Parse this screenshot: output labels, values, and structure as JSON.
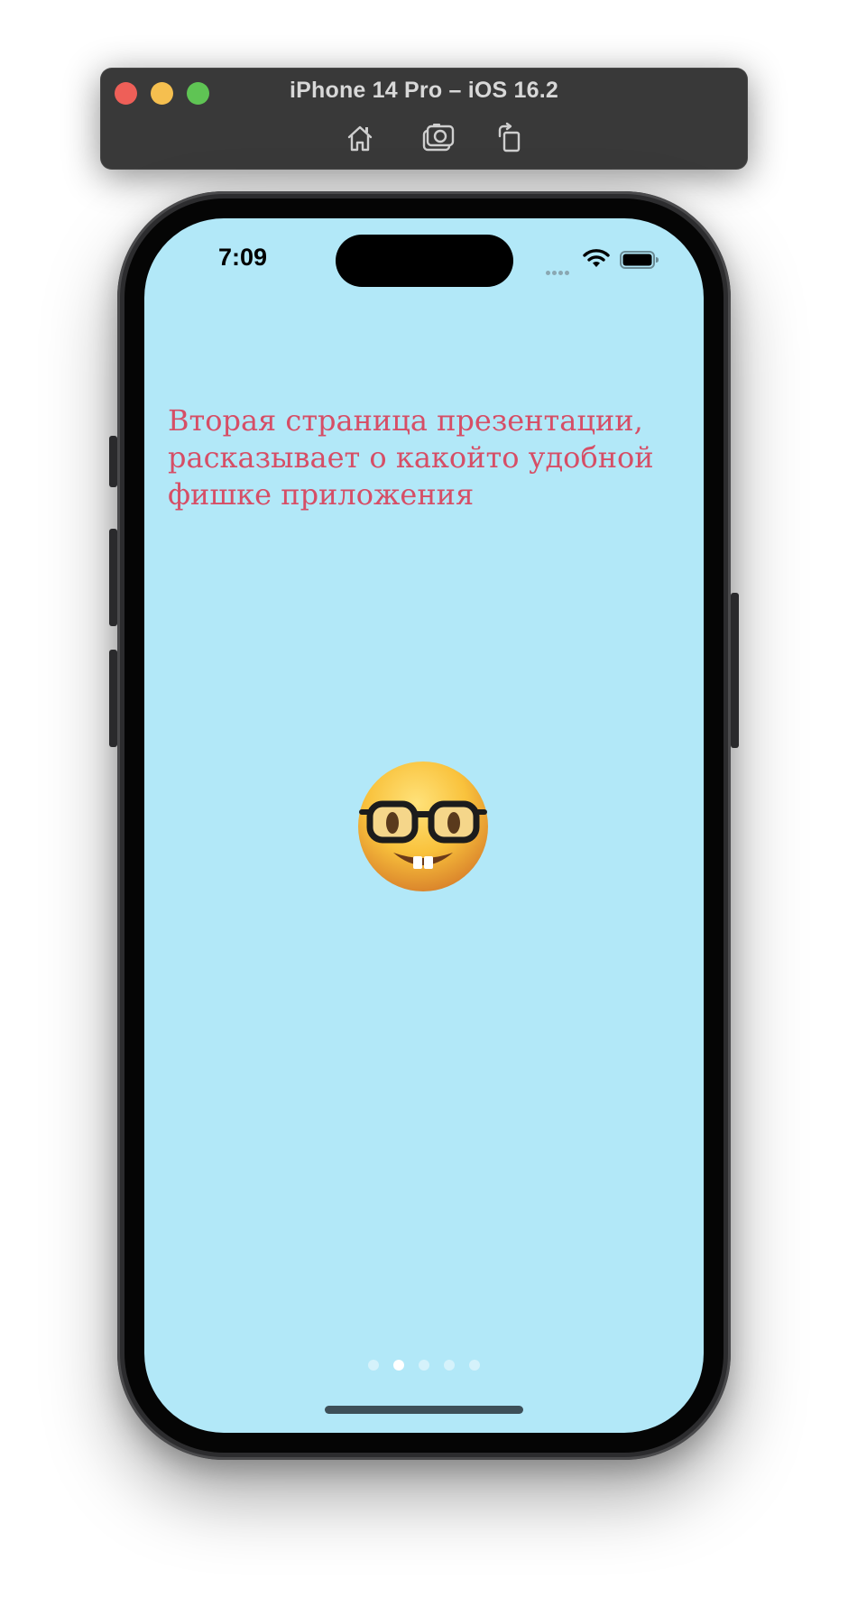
{
  "simulator": {
    "title": "iPhone 14 Pro – iOS 16.2",
    "toolbar": [
      {
        "icon": "home-icon"
      },
      {
        "icon": "screenshot-icon"
      },
      {
        "icon": "rotate-icon"
      }
    ]
  },
  "status_bar": {
    "time": "7:09",
    "icons": [
      "cellular-icon",
      "wifi-icon",
      "battery-icon"
    ]
  },
  "onboarding": {
    "title": "Вторая страница презентации, расказывает о какойто удобной фишке приложения",
    "emoji": "nerd-face-icon",
    "page_count": 5,
    "current_page": 2
  },
  "colors": {
    "screen_background": "#b2e8f8",
    "title_text": "#d64e66",
    "page_dot_active": "#ffffff",
    "page_dot_inactive": "rgba(255,255,255,0.45)"
  }
}
